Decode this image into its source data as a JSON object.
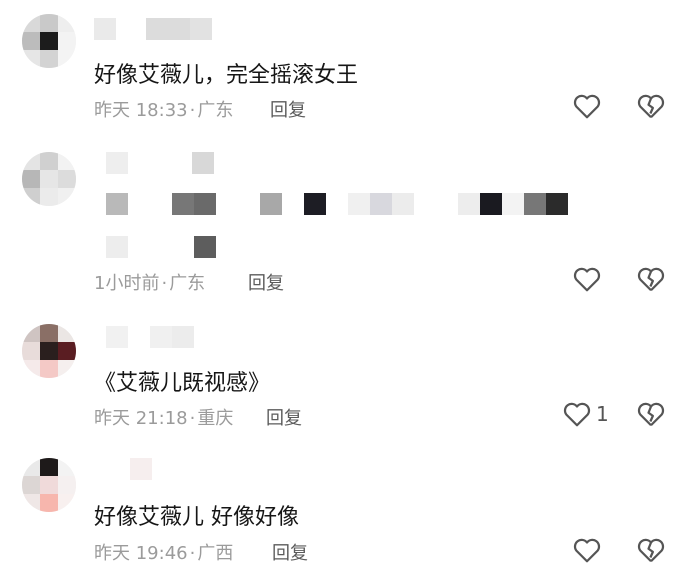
{
  "comments": [
    {
      "text": "好像艾薇儿，完全摇滚女王",
      "time": "昨天 18:33",
      "location": "广东",
      "reply_label": "回复",
      "likes": ""
    },
    {
      "text": "",
      "time": "1小时前",
      "location": "广东",
      "reply_label": "回复",
      "likes": ""
    },
    {
      "text": "《艾薇儿既视感》",
      "time": "昨天 21:18",
      "location": "重庆",
      "reply_label": "回复",
      "likes": "1"
    },
    {
      "text": "好像艾薇儿 好像好像",
      "time": "昨天 19:46",
      "location": "广西",
      "reply_label": "回复",
      "likes": ""
    }
  ],
  "separator": "·",
  "icons": {
    "like": "heart-outline-icon",
    "dislike": "broken-heart-icon"
  },
  "colors": {
    "text": "#161616",
    "meta": "#9b9b9b",
    "reply": "#5b5b5b",
    "icon": "#555555"
  }
}
